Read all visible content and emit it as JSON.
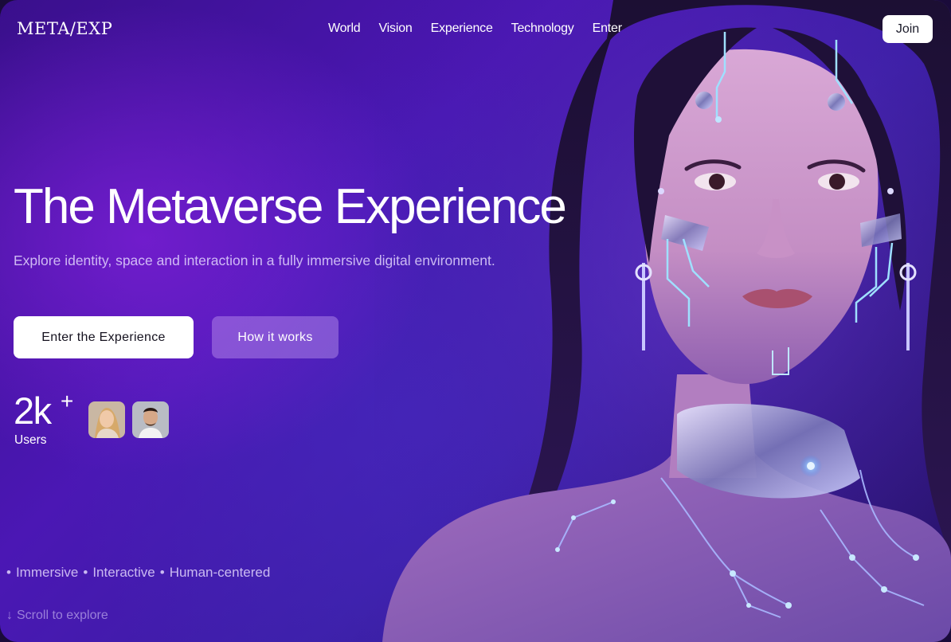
{
  "header": {
    "logo": "META/EXP",
    "nav": [
      {
        "label": "World"
      },
      {
        "label": "Vision"
      },
      {
        "label": "Experience"
      },
      {
        "label": "Technology"
      },
      {
        "label": "Enter"
      }
    ],
    "join_label": "Join"
  },
  "hero": {
    "title": "The Metaverse Experience",
    "subtitle": "Explore identity, space and interaction in a fully immersive digital environment.",
    "primary_cta": "Enter the Experience",
    "secondary_cta": "How it works"
  },
  "stats": {
    "users_count": "2k",
    "users_suffix": "+",
    "users_label": "Users"
  },
  "tags": [
    "Immersive",
    "Interactive",
    "Human-centered"
  ],
  "tag_bullet": "•",
  "scroll": {
    "icon": "arrow-down-icon",
    "arrow": "↓",
    "label": "Scroll to explore"
  },
  "colors": {
    "background_primary": "#3a0f8c",
    "background_accent": "#4b17b4",
    "button_primary_bg": "#ffffff",
    "button_secondary_bg": "#be96f0",
    "text_primary": "#ffffff"
  }
}
